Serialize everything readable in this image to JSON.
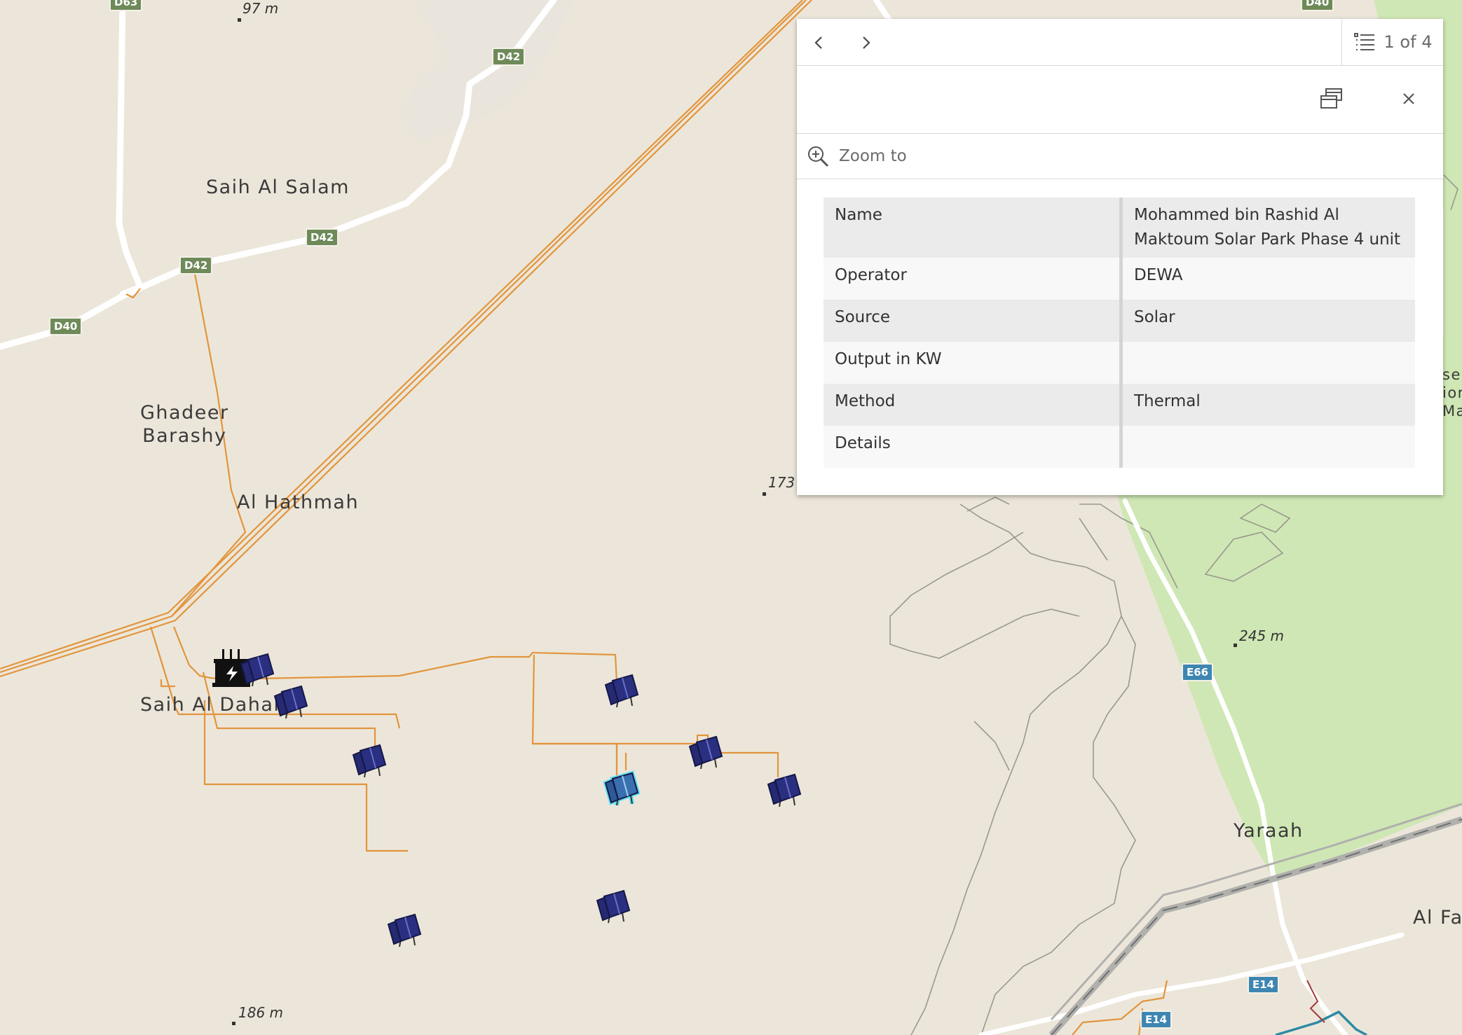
{
  "map": {
    "places": [
      {
        "id": "saih-al-salam",
        "text": "Saih Al Salam"
      },
      {
        "id": "ghadeer-barashy",
        "text": "Ghadeer\nBarashy"
      },
      {
        "id": "al-hathmah",
        "text": "Al Hathmah"
      },
      {
        "id": "saih-al-dahal",
        "text": "Saih Al Dahal"
      },
      {
        "id": "yaraah",
        "text": "Yaraah"
      },
      {
        "id": "al-fa",
        "text": "Al Fa"
      },
      {
        "id": "edge-label",
        "text": "ser\nior\nMa"
      }
    ],
    "elevations": [
      "97 m",
      "173",
      "245 m",
      "186 m"
    ],
    "road_shields": [
      "D63",
      "D42",
      "D42",
      "D42",
      "D40",
      "D40",
      "E66",
      "E14",
      "E14"
    ],
    "icons": {
      "solar": "solar-panel-icon",
      "substation": "substation-icon"
    }
  },
  "popup": {
    "prev_label": "previous-feature",
    "next_label": "next-feature",
    "page_text": "1 of 4",
    "zoom_label": "Zoom to",
    "fields": [
      {
        "key": "Name",
        "value": "Mohammed bin Rashid Al Maktoum Solar Park Phase 4 unit"
      },
      {
        "key": "Operator",
        "value": "DEWA"
      },
      {
        "key": "Source",
        "value": "Solar"
      },
      {
        "key": "Output in KW",
        "value": ""
      },
      {
        "key": "Method",
        "value": "Thermal"
      },
      {
        "key": "Details",
        "value": ""
      }
    ]
  },
  "colors": {
    "land": "#ece6da",
    "park": "#cfe7b4",
    "power_line": "#e2953c",
    "road": "#ffffff",
    "railway": "#a8a8a8",
    "panel": "#2a2f80",
    "highlight": "#5fe0f0",
    "water_line": "#2e8aa4"
  }
}
